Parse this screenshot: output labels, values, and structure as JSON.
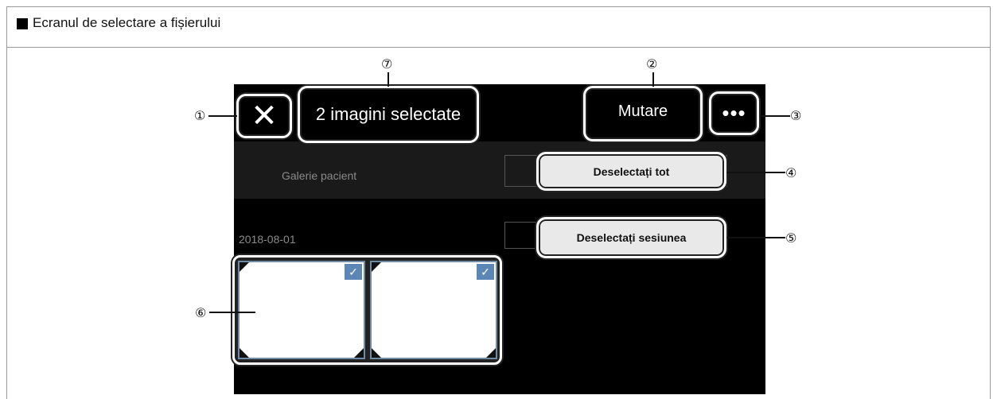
{
  "heading": "Ecranul de selectare a fișierului",
  "toolbar": {
    "close_icon": "✕",
    "title": "2 imagini selectate",
    "move_label": "Mutare",
    "more_icon": "•••"
  },
  "gallery": {
    "label": "Galerie pacient",
    "deselect_all": "Deselectați tot"
  },
  "session": {
    "date": "2018-08-01",
    "deselect_session": "Deselectați sesiunea"
  },
  "thumbnails": [
    {
      "checked": true,
      "check_icon": "✓"
    },
    {
      "checked": true,
      "check_icon": "✓"
    }
  ],
  "callouts": {
    "c1": "①",
    "c2": "②",
    "c3": "③",
    "c4": "④",
    "c5": "⑤",
    "c6": "⑥",
    "c7": "⑦"
  },
  "colors": {
    "screen_bg": "#000000",
    "selection_accent": "#5b86b5"
  }
}
